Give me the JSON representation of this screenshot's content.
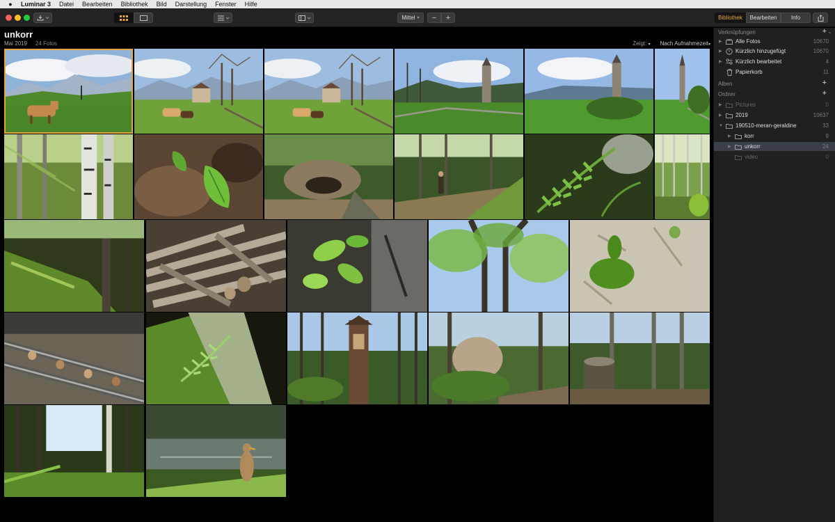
{
  "menubar": {
    "app_name": "Luminar 3",
    "items": [
      "Datei",
      "Bearbeiten",
      "Bibliothek",
      "Bild",
      "Darstellung",
      "Fenster",
      "Hilfe"
    ]
  },
  "toolbar": {
    "zoom_label": "Mittel",
    "zoom_out": "−",
    "zoom_in": "+",
    "tabs": [
      "Bibliothek",
      "Bearbeiten",
      "Info"
    ],
    "active_tab": "Bibliothek"
  },
  "gallery": {
    "title": "unkorr",
    "date": "Mai 2019",
    "count": "24 Fotos",
    "show_label": "Zeigt:",
    "sort_label": "Nach Aufnahmezeit"
  },
  "thumbnails": [
    {
      "scene": "alpine-horse",
      "selected": true
    },
    {
      "scene": "farm-horses"
    },
    {
      "scene": "farm-horses"
    },
    {
      "scene": "church-tower"
    },
    {
      "scene": "church-tower-far"
    },
    {
      "scene": "church-tower-edge"
    },
    {
      "scene": "birch-forest"
    },
    {
      "scene": "leaf-closeup"
    },
    {
      "scene": "forest-rock"
    },
    {
      "scene": "forest-hiker"
    },
    {
      "scene": "fern-closeup"
    },
    {
      "scene": "forest-trees"
    },
    {
      "scene": "mossy-rock"
    },
    {
      "scene": "woodpile"
    },
    {
      "scene": "green-leaves"
    },
    {
      "scene": "tree-canopy"
    },
    {
      "scene": "moss-stone"
    },
    {
      "scene": "rail-track"
    },
    {
      "scene": "fern-shadow"
    },
    {
      "scene": "wayside-shrine"
    },
    {
      "scene": "forest-boulder"
    },
    {
      "scene": "forest-stump"
    },
    {
      "scene": "sunny-forest"
    },
    {
      "scene": "pond-duck"
    }
  ],
  "sidebar": {
    "shortcuts_header": "Verknüpfungen",
    "shortcuts": [
      {
        "label": "Alle Fotos",
        "count": "10670",
        "icon": "photos-icon"
      },
      {
        "label": "Kürzlich hinzugefügt",
        "count": "10670",
        "icon": "recent-add-icon"
      },
      {
        "label": "Kürzlich bearbeitet",
        "count": "4",
        "icon": "recent-edit-icon"
      },
      {
        "label": "Papierkorb",
        "count": "11",
        "icon": "trash-icon"
      }
    ],
    "albums_header": "Alben",
    "folders_header": "Ordner",
    "folders": [
      {
        "label": "Pictures",
        "count": "0",
        "dim": true,
        "level": 0,
        "arrow": "▶"
      },
      {
        "label": "2019",
        "count": "10637",
        "level": 0,
        "arrow": "▶"
      },
      {
        "label": "190510-meran-geraldine",
        "count": "33",
        "level": 0,
        "arrow": "▼"
      },
      {
        "label": "korr",
        "count": "9",
        "level": 1,
        "arrow": "▶"
      },
      {
        "label": "unkorr",
        "count": "24",
        "level": 1,
        "arrow": "▶",
        "selected": true
      },
      {
        "label": "video",
        "count": "0",
        "dim": true,
        "level": 1,
        "arrow": ""
      }
    ]
  }
}
